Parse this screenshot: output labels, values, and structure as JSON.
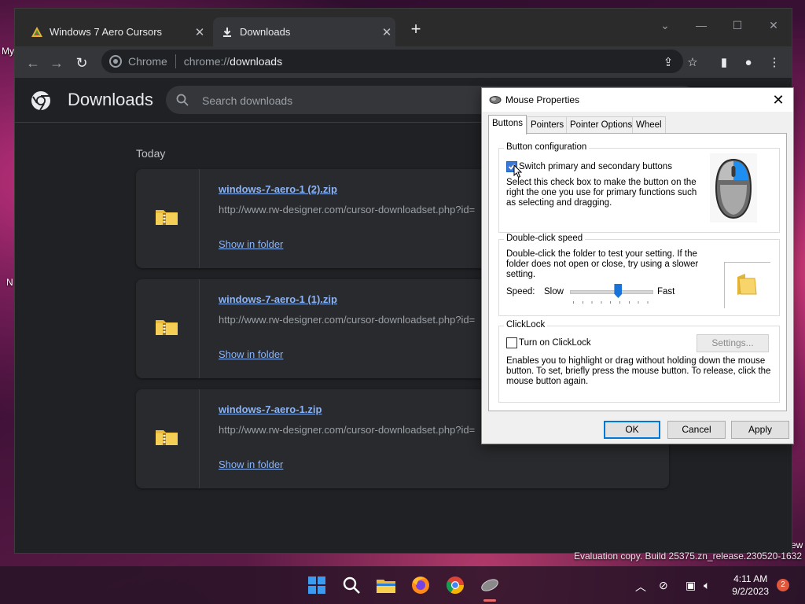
{
  "desktop": {
    "labels": [
      "My",
      "N",
      "ew"
    ]
  },
  "browser": {
    "tabs": [
      {
        "title": "Windows 7 Aero Cursors",
        "active": false
      },
      {
        "title": "Downloads",
        "active": true
      }
    ],
    "new_tab": "+",
    "omnibox": {
      "chip": "Chrome",
      "url_prefix": "chrome://",
      "url_host": "downloads"
    }
  },
  "downloads": {
    "title": "Downloads",
    "search_placeholder": "Search downloads",
    "section": "Today",
    "items": [
      {
        "name": "windows-7-aero-1 (2).zip",
        "url": "http://www.rw-designer.com/cursor-downloadset.php?id=",
        "action": "Show in folder"
      },
      {
        "name": "windows-7-aero-1 (1).zip",
        "url": "http://www.rw-designer.com/cursor-downloadset.php?id=",
        "action": "Show in folder"
      },
      {
        "name": "windows-7-aero-1.zip",
        "url": "http://www.rw-designer.com/cursor-downloadset.php?id=",
        "action": "Show in folder"
      }
    ]
  },
  "dialog": {
    "title": "Mouse Properties",
    "tabs": [
      "Buttons",
      "Pointers",
      "Pointer Options",
      "Wheel"
    ],
    "button_config": {
      "legend": "Button configuration",
      "checkbox_label": "Switch primary and secondary buttons",
      "checked": true,
      "description_lines": [
        "Select this check box to make the button on the",
        "right the one you use for primary functions such",
        "as selecting and dragging."
      ]
    },
    "double_click": {
      "legend": "Double-click speed",
      "description_lines": [
        "Double-click the folder to test your setting. If the",
        "folder does not open or close, try using a slower",
        "setting."
      ],
      "speed_label": "Speed:",
      "slow": "Slow",
      "fast": "Fast",
      "speed_value": 0.6
    },
    "clicklock": {
      "legend": "ClickLock",
      "checkbox_label": "Turn on ClickLock",
      "checked": false,
      "settings_button": "Settings...",
      "description_lines": [
        "Enables you to highlight or drag without holding down the mouse",
        "button. To set, briefly press the mouse button. To release, click the",
        "mouse button again."
      ]
    },
    "buttons": {
      "ok": "OK",
      "cancel": "Cancel",
      "apply": "Apply"
    }
  },
  "taskbar": {
    "time": "4:11 AM",
    "date": "9/2/2023",
    "notifications": "2",
    "watermark": "Evaluation copy. Build 25375.zn_release.230520-1632"
  },
  "colors": {
    "accent": "#8ab4f8",
    "dialog_accent": "#0078d7",
    "browser_bg": "#202124"
  }
}
